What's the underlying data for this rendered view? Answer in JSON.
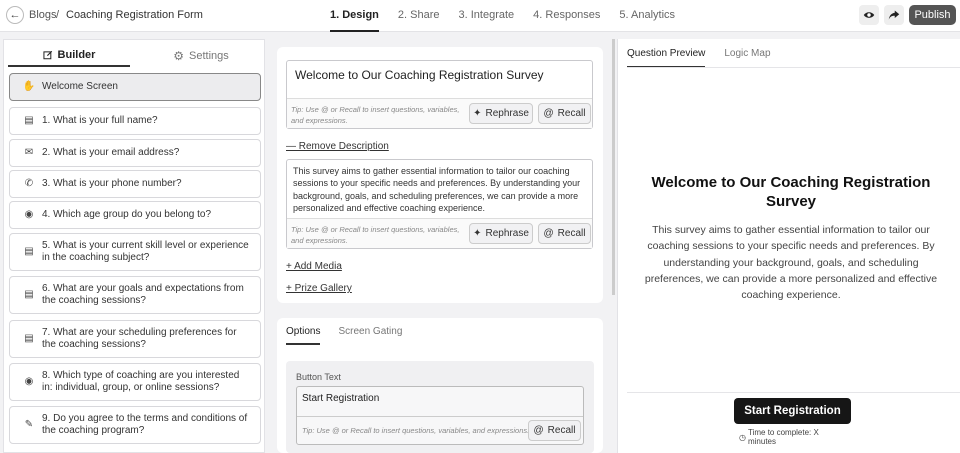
{
  "header": {
    "breadcrumb_root": "Blogs",
    "breadcrumb_sep": "/",
    "breadcrumb_current": "Coaching Registration Form",
    "tabs": [
      "1. Design",
      "2. Share",
      "3. Integrate",
      "4. Responses",
      "5. Analytics"
    ],
    "publish_label": "Publish"
  },
  "sidebar": {
    "tab_builder": "Builder",
    "tab_settings": "Settings",
    "items": [
      {
        "label": "Welcome Screen",
        "icon": "hand-wave-icon"
      },
      {
        "label": "1. What is your full name?",
        "icon": "text-lines-icon"
      },
      {
        "label": "2. What is your email address?",
        "icon": "envelope-icon"
      },
      {
        "label": "3. What is your phone number?",
        "icon": "phone-icon"
      },
      {
        "label": "4. Which age group do you belong to?",
        "icon": "radio-icon"
      },
      {
        "label": "5. What is your current skill level or experience in the coaching subject?",
        "icon": "text-lines-icon"
      },
      {
        "label": "6. What are your goals and expectations from the coaching sessions?",
        "icon": "text-lines-icon"
      },
      {
        "label": "7. What are your scheduling preferences for the coaching sessions?",
        "icon": "text-lines-icon"
      },
      {
        "label": "8. Which type of coaching are you interested in: individual, group, or online sessions?",
        "icon": "radio-icon"
      },
      {
        "label": "9. Do you agree to the terms and conditions of the coaching program?",
        "icon": "signature-icon"
      }
    ]
  },
  "editor": {
    "title_value": "Welcome to Our Coaching Registration Survey",
    "tip": "Tip: Use @ or Recall to insert questions, variables, and expressions.",
    "rephrase_label": "Rephrase",
    "recall_label": "Recall",
    "remove_description": "— Remove Description",
    "description_value": "This survey aims to gather essential information to tailor our coaching sessions to your specific needs and preferences. By understanding your background, goals, and scheduling preferences, we can provide a more personalized and effective coaching experience.",
    "add_media": "+ Add Media",
    "prize_gallery": "+ Prize Gallery"
  },
  "options": {
    "tab_options": "Options",
    "tab_screen_gating": "Screen Gating",
    "button_text_label": "Button Text",
    "button_text_value": "Start Registration",
    "tip": "Tip: Use @ or Recall to insert questions, variables, and expressions.",
    "recall_label": "Recall"
  },
  "preview": {
    "tab_question_preview": "Question Preview",
    "tab_logic_map": "Logic Map",
    "title": "Welcome to Our Coaching Registration Survey",
    "description": "This survey aims to gather essential information to tailor our coaching sessions to your specific needs and preferences. By understanding your background, goals, and scheduling preferences, we can provide a more personalized and effective coaching experience.",
    "start_button": "Start Registration",
    "time_text": "Time to complete: X minutes"
  }
}
